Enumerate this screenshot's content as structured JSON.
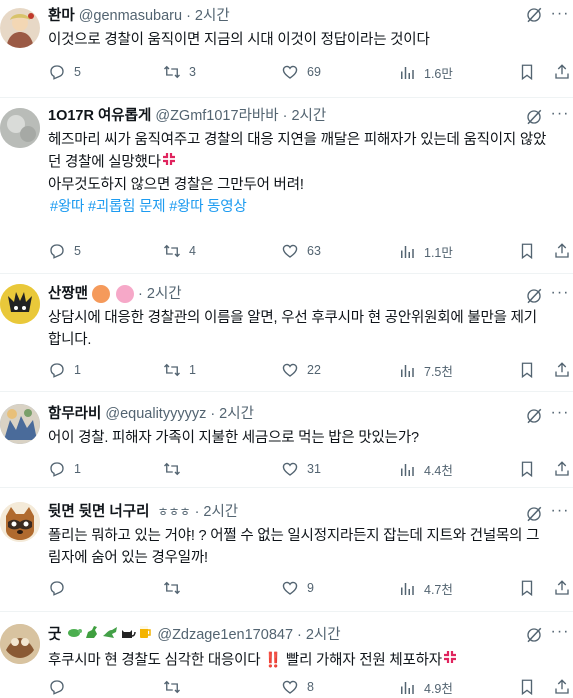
{
  "tweets": [
    {
      "name": "환마",
      "handle": "@genmasubaru",
      "time": "2시간",
      "lines": [
        "이것으로 경찰이 움직이면 지금의 시대 이것이 정답이라는 것이다"
      ],
      "replies": "5",
      "retweets": "3",
      "likes": "69",
      "views": "1.6만"
    },
    {
      "name": "1O17R 여유롭게",
      "handle": "@ZGmf1017라바바",
      "time": "2시간",
      "lines": [
        "헤즈마리 씨가 움직여주고 경찰의 대응 지연을 깨달은 피해자가 있는데 움직이지 않았",
        "던 경찰에 실망했다",
        "아무것도하지 않으면 경찰은 그만두어 버려!"
      ],
      "hashtags": "#왕따 #괴롭힘 문제 #왕따 동영상",
      "replies": "5",
      "retweets": "4",
      "likes": "63",
      "views": "1.1만"
    },
    {
      "name": "산짱맨",
      "time": "2시간",
      "lines": [
        "상담시에 대응한 경찰관의 이름을 알면, 우선 후쿠시마 현 공안위원회에 불만을 제기",
        "합니다."
      ],
      "replies": "1",
      "retweets": "1",
      "likes": "22",
      "views": "7.5천"
    },
    {
      "name": "함무라비",
      "handle": "@equalityyyyyz",
      "time": "2시간",
      "lines": [
        "어이 경찰. 피해자 가족이 지불한 세금으로 먹는 밥은 맛있는가?"
      ],
      "replies": "1",
      "retweets": "",
      "likes": "31",
      "views": "4.4천"
    },
    {
      "name": "뒷면 뒷면 너구리",
      "suffix": "ㅎㅎㅎ",
      "time": "2시간",
      "lines": [
        "폴리는 뭐하고 있는 거야! ? 어쩔 수 없는 일시정지라든지 잡는데 지트와 건널목의 그",
        "림자에 숨어 있는 경우일까!"
      ],
      "replies": "",
      "retweets": "",
      "likes": "9",
      "views": "4.7천"
    },
    {
      "name": "굿",
      "handle": "@Zdzage1en170847",
      "time": "2시간",
      "lines": [
        "후쿠시마 현 경찰도 심각한 대응이다 ‼️ 빨리 가해자 전원 체포하자"
      ],
      "replies": "",
      "retweets": "",
      "likes": "8",
      "views": "4.9천"
    }
  ],
  "colors": {
    "accent": "#1d9bf0",
    "muted": "#536471",
    "text": "#0f1419",
    "divider": "#eff3f4"
  }
}
